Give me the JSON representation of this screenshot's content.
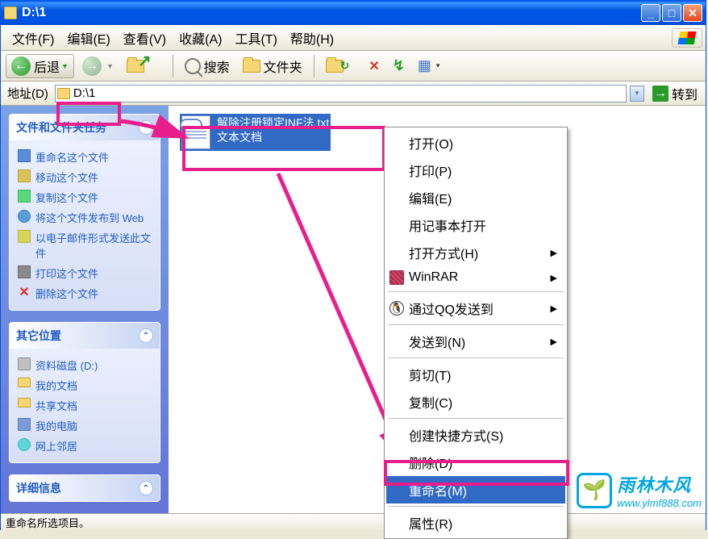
{
  "titlebar": {
    "title": "D:\\1"
  },
  "menubar": {
    "file": "文件(F)",
    "edit": "编辑(E)",
    "view": "查看(V)",
    "favorites": "收藏(A)",
    "tools": "工具(T)",
    "help": "帮助(H)"
  },
  "toolbar": {
    "back": "后退",
    "search": "搜索",
    "folders": "文件夹"
  },
  "addressbar": {
    "label": "地址(D)",
    "path": "D:\\1",
    "go": "转到"
  },
  "sidebar": {
    "tasks": {
      "title": "文件和文件夹任务",
      "items": [
        {
          "label": "重命名这个文件",
          "icon": "rename"
        },
        {
          "label": "移动这个文件",
          "icon": "move"
        },
        {
          "label": "复制这个文件",
          "icon": "copy"
        },
        {
          "label": "将这个文件发布到 Web",
          "icon": "web"
        },
        {
          "label": "以电子邮件形式发送此文件",
          "icon": "mail"
        },
        {
          "label": "打印这个文件",
          "icon": "print"
        },
        {
          "label": "删除这个文件",
          "icon": "delete"
        }
      ]
    },
    "places": {
      "title": "其它位置",
      "items": [
        {
          "label": "资料磁盘 (D:)",
          "icon": "disk"
        },
        {
          "label": "我的文档",
          "icon": "folder"
        },
        {
          "label": "共享文档",
          "icon": "folder"
        },
        {
          "label": "我的电脑",
          "icon": "computer"
        },
        {
          "label": "网上邻居",
          "icon": "network"
        }
      ]
    },
    "details": {
      "title": "详细信息"
    }
  },
  "file": {
    "name": "解除注册锁定INF法.txt",
    "type": "文本文档"
  },
  "contextmenu": {
    "open": "打开(O)",
    "print": "打印(P)",
    "edit": "编辑(E)",
    "notepad": "用记事本打开",
    "openwith": "打开方式(H)",
    "winrar": "WinRAR",
    "qq": "通过QQ发送到",
    "sendto": "发送到(N)",
    "cut": "剪切(T)",
    "copy": "复制(C)",
    "shortcut": "创建快捷方式(S)",
    "delete": "删除(D)",
    "rename": "重命名(M)",
    "properties": "属性(R)"
  },
  "statusbar": {
    "text": "重命名所选项目。"
  },
  "watermark": {
    "name": "雨林木风",
    "url": "www.ylmf888.com"
  },
  "colors": {
    "xp_blue": "#0054e3",
    "highlight": "#316ac5",
    "annotation": "#e91e8c",
    "brand": "#00a5e3"
  }
}
